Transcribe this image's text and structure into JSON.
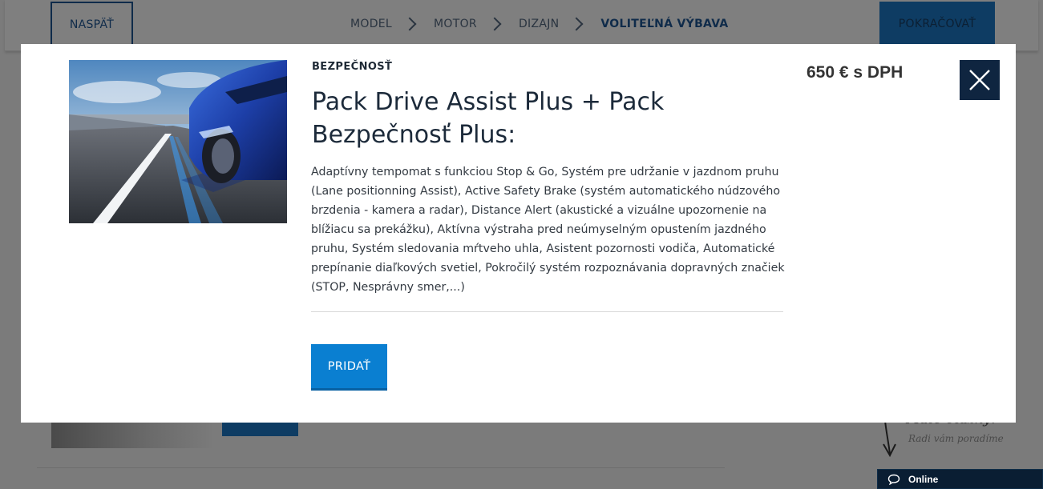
{
  "header": {
    "back_label": "NASPÄŤ",
    "continue_label": "POKRAČOVAŤ",
    "steps": [
      {
        "label": "MODEL",
        "active": false
      },
      {
        "label": "MOTOR",
        "active": false
      },
      {
        "label": "DIZAJN",
        "active": false
      },
      {
        "label": "VOLITEĽNÁ VÝBAVA",
        "active": true
      }
    ]
  },
  "modal": {
    "category": "BEZPEČNOSŤ",
    "title": "Pack Drive Assist Plus + Pack Bezpečnosť Plus:",
    "description": "Adaptívny tempomat s funkciou Stop & Go, Systém pre udržanie v jazdnom pruhu (Lane positionning Assist), Active Safety Brake (systém automatického núdzového brzdenia - kamera a radar), Distance Alert (akustické a vizuálne upozornenie na blížiacu sa prekážku), Aktívna výstraha pred neúmyselným opustením jazdného pruhu, Systém sledovania mŕtveho uhla, Asistent pozornosti vodiča, Automatické prepínanie diaľkových svetiel, Pokročilý systém rozpoznávania dopravných značiek (STOP, Nesprávny smer,...)",
    "add_label": "PRIDAŤ",
    "price": "650 € s DPH",
    "close_icon": "close-icon",
    "image_icon": "car-lane-assist-image"
  },
  "help": {
    "title": "Máte otázky?",
    "subtitle": "Radi vám poradíme"
  },
  "chat": {
    "label": "Online",
    "icon": "chat-bubble-icon"
  },
  "colors": {
    "navy": "#0f2540",
    "accent_blue": "#0a7fd1",
    "overlay": "#7b7b7b"
  }
}
